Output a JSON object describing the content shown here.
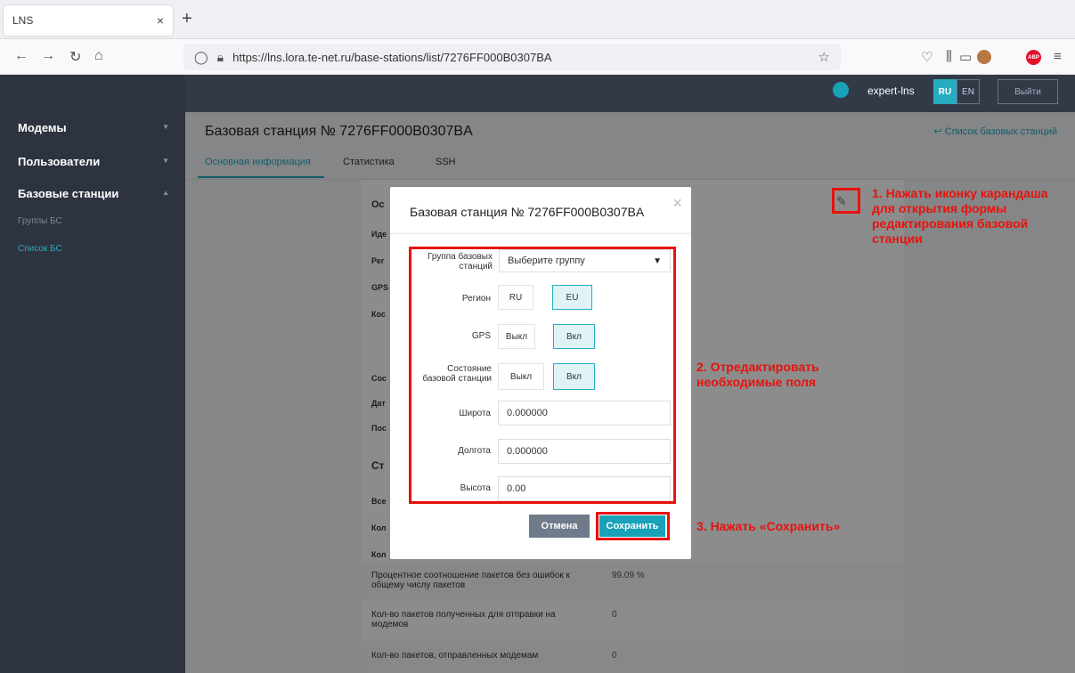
{
  "browser": {
    "tab_title": "LNS",
    "tab_close": "×",
    "new_tab": "+",
    "url": "https://lns.lora.te-net.ru/base-stations/list/7276FF000B0307BA"
  },
  "header": {
    "user": "expert-lns",
    "lang_ru": "RU",
    "lang_en": "EN",
    "logout": "Выйти"
  },
  "sidebar": {
    "modems": "Модемы",
    "users": "Пользователи",
    "base_stations": "Базовые станции",
    "groups": "Группы БС",
    "list": "Список БС"
  },
  "page": {
    "title": "Базовая станция № 7276FF000B0307BA",
    "back_link": "Список базовых станций",
    "tabs": [
      "Основная информация",
      "Статистика",
      "SSH"
    ]
  },
  "card": {
    "stubs": [
      "Ос",
      "Иде",
      "Рег",
      "GPS",
      "Кос",
      "Сос",
      "Дат",
      "Пос",
      "Ст",
      "Все",
      "Кол",
      "Кол"
    ],
    "rows": [
      {
        "label": "Процентное соотношение пакетов без ошибок к общему числу пакетов",
        "value": "99.09 %"
      },
      {
        "label": "Кол-во пакетов полученных для отправки на модемов",
        "value": "0"
      },
      {
        "label": "Кол-во пакетов, отправленных модемам",
        "value": "0"
      }
    ]
  },
  "modal": {
    "title": "Базовая станция № 7276FF000B0307BA",
    "group_label": "Группа базовых станций",
    "group_value": "Выберите группу",
    "region_label": "Регион",
    "region_ru": "RU",
    "region_eu": "EU",
    "gps_label": "GPS",
    "gps_off": "Выкл",
    "gps_on": "Вкл",
    "state_label": "Состояние базовой станции",
    "state_off": "Выкл",
    "state_on": "Вкл",
    "lat_label": "Широта",
    "lat_value": "0.000000",
    "lon_label": "Долгота",
    "lon_value": "0.000000",
    "alt_label": "Высота",
    "alt_value": "0.00",
    "cancel": "Отмена",
    "save": "Сохранить"
  },
  "annotations": {
    "step1": "1. Нажать иконку карандаша для открытия формы редактирования базовой станции",
    "step2": "2. Отредактировать необходимые поля",
    "step3": "3. Нажать «Сохранить»"
  },
  "colors": {
    "accent": "#26abc2",
    "annotation_red": "#e8120c",
    "sidebar": "#2d3440"
  }
}
